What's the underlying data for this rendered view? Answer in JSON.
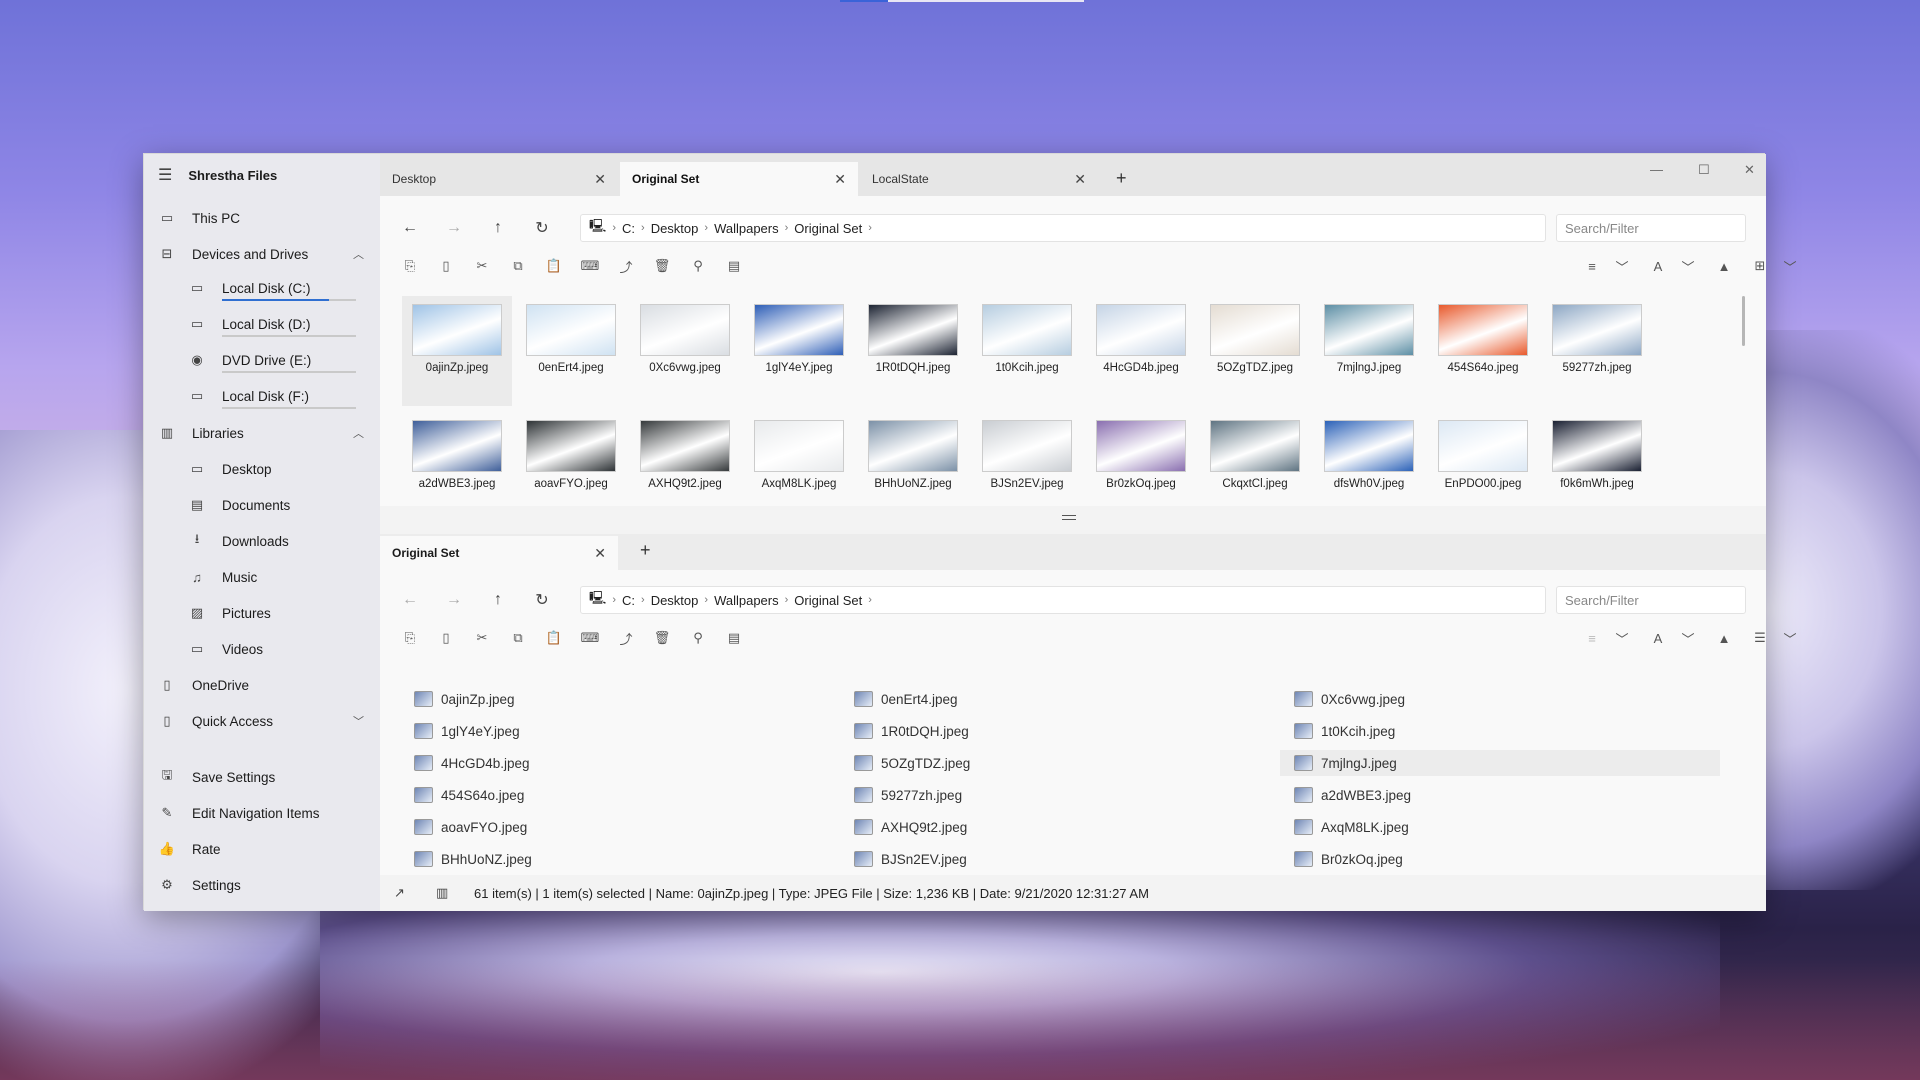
{
  "app": {
    "title": "Shrestha Files"
  },
  "window_controls": {
    "minimize": "—",
    "maximize": "☐",
    "close": "✕"
  },
  "sidebar": {
    "this_pc": "This PC",
    "devices_header": "Devices and Drives",
    "drives": [
      {
        "label": "Local Disk (C:)",
        "used": 0.8
      },
      {
        "label": "Local Disk (D:)",
        "used": 0.0
      },
      {
        "label": "DVD Drive (E:)",
        "used": 0.0
      },
      {
        "label": "Local Disk (F:)",
        "used": 0.0
      }
    ],
    "libraries_header": "Libraries",
    "libraries": [
      "Desktop",
      "Documents",
      "Downloads",
      "Music",
      "Pictures",
      "Videos"
    ],
    "onedrive": "OneDrive",
    "quick_access": "Quick Access",
    "footer": [
      "Save Settings",
      "Edit Navigation Items",
      "Rate",
      "Settings"
    ]
  },
  "top_tabs": [
    "Desktop",
    "Original Set",
    "LocalState"
  ],
  "top_tab_add": "+",
  "bottom_tabs": [
    "Original Set"
  ],
  "breadcrumb": {
    "root": "C:",
    "parts": [
      "Desktop",
      "Wallpapers",
      "Original Set"
    ]
  },
  "search": {
    "placeholder": "Search/Filter"
  },
  "grid_files": [
    "0ajinZp.jpeg",
    "0enErt4.jpeg",
    "0Xc6vwg.jpeg",
    "1glY4eY.jpeg",
    "1R0tDQH.jpeg",
    "1t0Kcih.jpeg",
    "4HcGD4b.jpeg",
    "5OZgTDZ.jpeg",
    "7mjlngJ.jpeg",
    "454S64o.jpeg",
    "59277zh.jpeg",
    "a2dWBE3.jpeg",
    "aoavFYO.jpeg",
    "AXHQ9t2.jpeg",
    "AxqM8LK.jpeg",
    "BHhUoNZ.jpeg",
    "BJSn2EV.jpeg",
    "Br0zkOq.jpeg",
    "CkqxtCl.jpeg",
    "dfsWh0V.jpeg",
    "EnPDO00.jpeg",
    "f0k6mWh.jpeg"
  ],
  "thumb_colors": [
    "#9fc3e6",
    "#cfe2f2",
    "#d9dde2",
    "#2f5fb7",
    "#1d2433",
    "#b6cde0",
    "#c5d4e6",
    "#e4dcd2",
    "#5d8fa5",
    "#e85a2d",
    "#8da7c4",
    "#3f5f9a",
    "#2e3336",
    "#363a3c",
    "#e8eaec",
    "#7c91a7",
    "#c9cdd2",
    "#8a6fb0",
    "#5f7482",
    "#2c62b8",
    "#dce8f4",
    "#1a2032"
  ],
  "list_files": [
    [
      "0ajinZp.jpeg",
      "0enErt4.jpeg",
      "0Xc6vwg.jpeg"
    ],
    [
      "1glY4eY.jpeg",
      "1R0tDQH.jpeg",
      "1t0Kcih.jpeg"
    ],
    [
      "4HcGD4b.jpeg",
      "5OZgTDZ.jpeg",
      "7mjlngJ.jpeg"
    ],
    [
      "454S64o.jpeg",
      "59277zh.jpeg",
      "a2dWBE3.jpeg"
    ],
    [
      "aoavFYO.jpeg",
      "AXHQ9t2.jpeg",
      "AxqM8LK.jpeg"
    ],
    [
      "BHhUoNZ.jpeg",
      "BJSn2EV.jpeg",
      "Br0zkOq.jpeg"
    ]
  ],
  "status": {
    "text": "61 item(s)  | 1 item(s) selected |  Name: 0ajinZp.jpeg | Type: JPEG File | Size: 1,236 KB | Date: 9/21/2020 12:31:27 AM"
  },
  "colors": {
    "accent": "#2f6fd1",
    "sidebar_bg": "#e9e9ee",
    "pane_bg": "#f9f9f9"
  }
}
